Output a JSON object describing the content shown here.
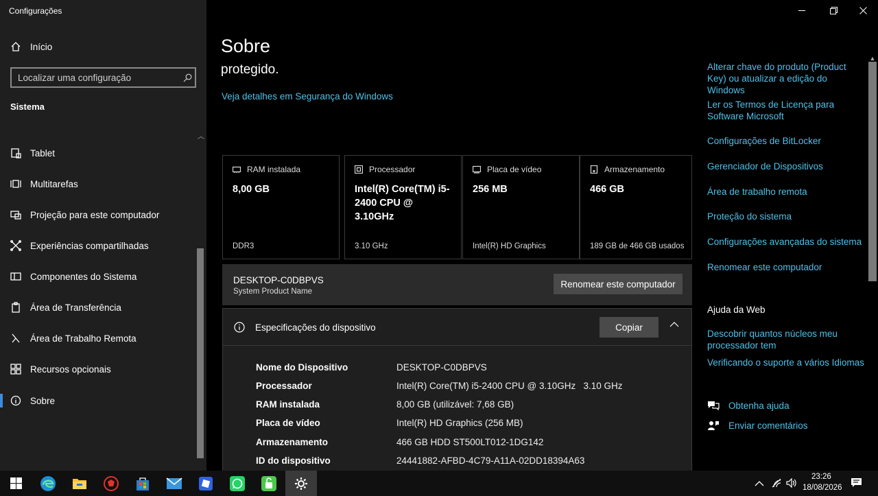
{
  "window": {
    "title": "Configurações"
  },
  "sidebar": {
    "home_label": "Início",
    "search_placeholder": "Localizar uma configuração",
    "section": "Sistema",
    "items": [
      {
        "label": "Tablet",
        "icon": "tablet-icon"
      },
      {
        "label": "Multitarefas",
        "icon": "multitask-icon"
      },
      {
        "label": "Projeção para este computador",
        "icon": "projection-icon"
      },
      {
        "label": "Experiências compartilhadas",
        "icon": "shared-icon"
      },
      {
        "label": "Componentes do Sistema",
        "icon": "components-icon"
      },
      {
        "label": "Área de Transferência",
        "icon": "clipboard-icon"
      },
      {
        "label": "Área de Trabalho Remota",
        "icon": "remote-icon"
      },
      {
        "label": "Recursos opcionais",
        "icon": "features-icon"
      },
      {
        "label": "Sobre",
        "icon": "info-icon",
        "active": true
      }
    ]
  },
  "main": {
    "title": "Sobre",
    "protected_text": "protegido.",
    "security_link": "Veja detalhes em Segurança do Windows",
    "cards": [
      {
        "label": "RAM instalada",
        "value": "8,00 GB",
        "sub": "DDR3"
      },
      {
        "label": "Processador",
        "value": "Intel(R) Core(TM) i5-2400 CPU @ 3.10GHz",
        "sub": "3.10 GHz"
      },
      {
        "label": "Placa de vídeo",
        "value": "256 MB",
        "sub": "Intel(R) HD Graphics"
      },
      {
        "label": "Armazenamento",
        "value": "466 GB",
        "sub": "189 GB de 466 GB usados"
      }
    ],
    "device": {
      "name": "DESKTOP-C0DBPVS",
      "sub": "System Product Name",
      "rename_label": "Renomear este computador"
    },
    "specs": {
      "title": "Especificações do dispositivo",
      "copy_label": "Copiar",
      "rows": [
        {
          "key": "Nome do Dispositivo",
          "value": "DESKTOP-C0DBPVS"
        },
        {
          "key": "Processador",
          "value": "Intel(R) Core(TM) i5-2400 CPU @ 3.10GHz   3.10 GHz"
        },
        {
          "key": "RAM instalada",
          "value": "8,00 GB (utilizável: 7,68 GB)"
        },
        {
          "key": "Placa de vídeo",
          "value": "Intel(R) HD Graphics (256 MB)"
        },
        {
          "key": "Armazenamento",
          "value": "466 GB HDD ST500LT012-1DG142"
        },
        {
          "key": "ID do dispositivo",
          "value": "24441882-AFBD-4C79-A11A-02DD18394A63"
        }
      ]
    }
  },
  "right": {
    "links": [
      "Alterar chave do produto (Product Key) ou atualizar a edição do Windows",
      "Ler os Termos de Licença para Software Microsoft",
      "Configurações de BitLocker",
      "Gerenciador de Dispositivos",
      "Área de trabalho remota",
      "Proteção do sistema",
      "Configurações avançadas do sistema",
      "Renomear este computador"
    ],
    "web_help_title": "Ajuda da Web",
    "web_help_links": [
      "Descobrir quantos núcleos meu processador tem",
      "Verificando o suporte a vários Idiomas"
    ],
    "get_help": "Obtenha ajuda",
    "feedback": "Enviar comentários"
  },
  "taskbar": {
    "time": "23:26",
    "date": "18/08/2026",
    "apps": [
      "windows-start",
      "edge",
      "file-explorer",
      "app-red",
      "store",
      "mail",
      "app-blue",
      "whatsapp",
      "app-green",
      "settings"
    ]
  },
  "colors": {
    "accent": "#4fc1e9",
    "active_indicator": "#3a8de0"
  }
}
